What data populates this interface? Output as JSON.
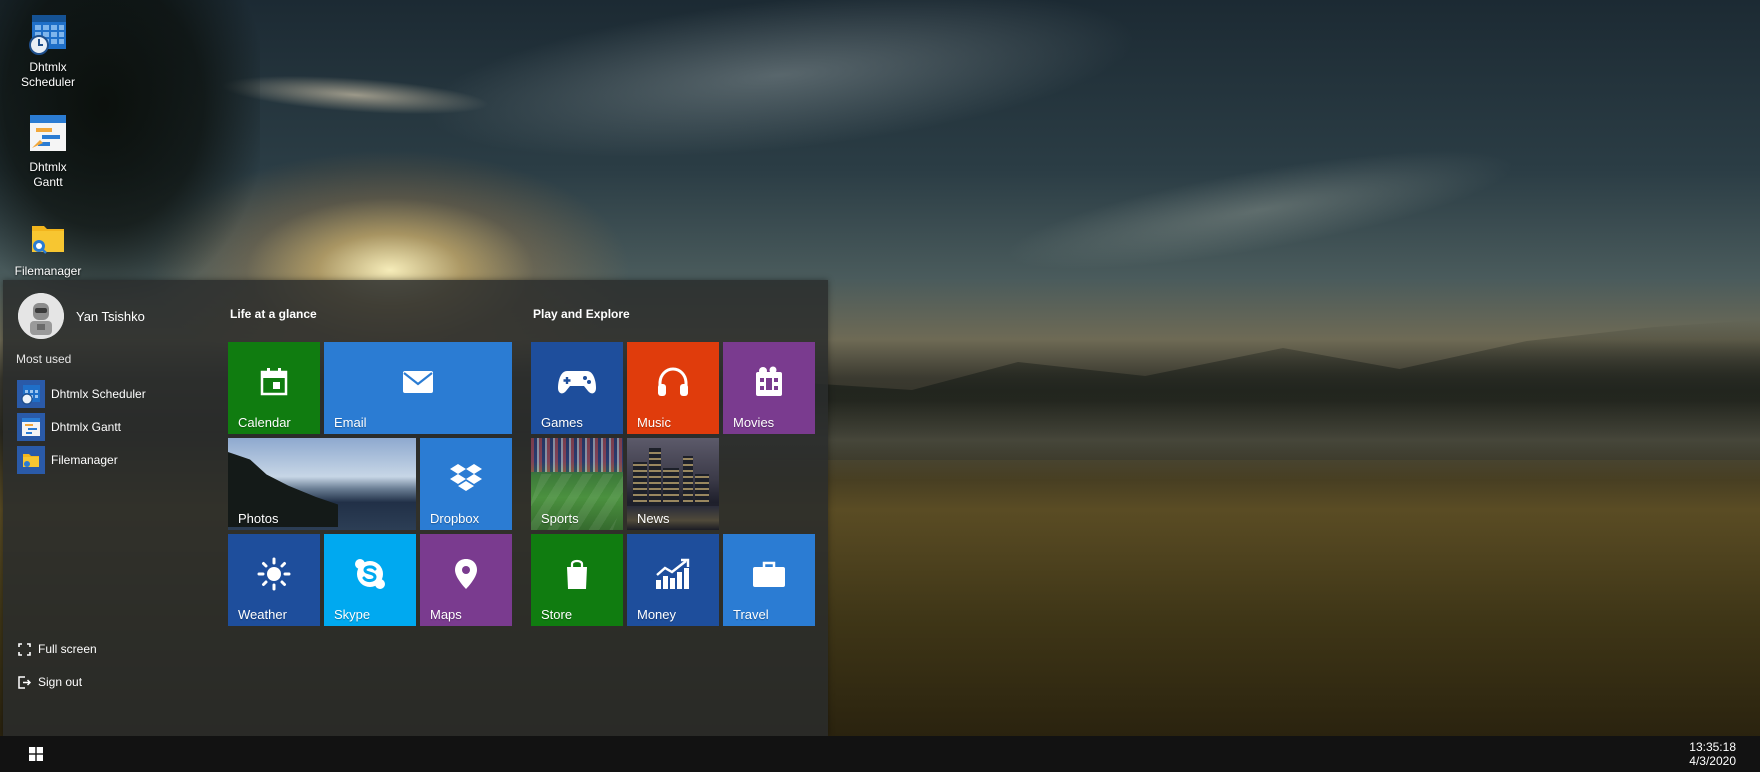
{
  "desktop": {
    "icons": [
      {
        "label": "Dhtmlx\nScheduler",
        "icon": "scheduler-app-icon"
      },
      {
        "label": "Dhtmlx\nGantt",
        "icon": "gantt-app-icon"
      },
      {
        "label": "Filemanager",
        "icon": "filemanager-app-icon"
      }
    ]
  },
  "start_menu": {
    "user": {
      "name": "Yan Tsishko",
      "icon": "user-avatar"
    },
    "most_used_label": "Most used",
    "most_used": [
      {
        "label": "Dhtmlx Scheduler",
        "icon": "scheduler-app-icon"
      },
      {
        "label": "Dhtmlx Gantt",
        "icon": "gantt-app-icon"
      },
      {
        "label": "Filemanager",
        "icon": "filemanager-app-icon"
      }
    ],
    "full_screen_label": "Full screen",
    "sign_out_label": "Sign out",
    "groups": [
      {
        "title": "Life at a glance",
        "tiles": [
          {
            "label": "Calendar",
            "icon": "calendar-icon",
            "color": "#107c10"
          },
          {
            "label": "Email",
            "icon": "mail-icon",
            "color": "#2b7cd3"
          },
          {
            "label": "Photos",
            "icon": "photo-tile-image",
            "color": "#6b7f95"
          },
          {
            "label": "Dropbox",
            "icon": "dropbox-icon",
            "color": "#2b7cd3"
          },
          {
            "label": "Weather",
            "icon": "sun-icon",
            "color": "#1e4e9c"
          },
          {
            "label": "Skype",
            "icon": "skype-icon",
            "color": "#00a9f0"
          },
          {
            "label": "Maps",
            "icon": "map-pin-icon",
            "color": "#7a3b8f"
          }
        ]
      },
      {
        "title": "Play and Explore",
        "tiles": [
          {
            "label": "Games",
            "icon": "gamepad-icon",
            "color": "#1e4e9c"
          },
          {
            "label": "Music",
            "icon": "headphones-icon",
            "color": "#e03c0c"
          },
          {
            "label": "Movies",
            "icon": "film-icon",
            "color": "#7a3b8f"
          },
          {
            "label": "Sports",
            "icon": "sports-tile-image",
            "color": "#3d7a3a"
          },
          {
            "label": "News",
            "icon": "news-tile-image",
            "color": "#3b3a48"
          },
          {
            "label": "Store",
            "icon": "shopping-bag-icon",
            "color": "#107c10"
          },
          {
            "label": "Money",
            "icon": "chart-up-icon",
            "color": "#1e4e9c"
          },
          {
            "label": "Travel",
            "icon": "suitcase-icon",
            "color": "#2b7cd3"
          }
        ]
      }
    ]
  },
  "taskbar": {
    "start_icon": "windows-logo-icon",
    "time": "13:35:18",
    "date": "4/3/2020"
  }
}
